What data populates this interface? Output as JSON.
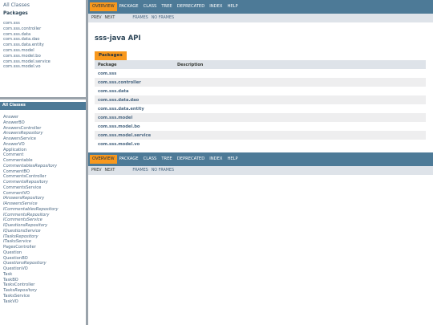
{
  "left_top": {
    "all_classes_link": "All Classes",
    "packages_title": "Packages",
    "packages": [
      "com.sss",
      "com.sss.controller",
      "com.sss.data",
      "com.sss.data.dao",
      "com.sss.data.entity",
      "com.sss.model",
      "com.sss.model.bo",
      "com.sss.model.service",
      "com.sss.model.vo"
    ]
  },
  "left_bottom": {
    "title": "All Classes",
    "classes": [
      {
        "name": "Answer",
        "interface": false
      },
      {
        "name": "AnswerBO",
        "interface": false
      },
      {
        "name": "AnswersController",
        "interface": false
      },
      {
        "name": "AnswersRepository",
        "interface": true
      },
      {
        "name": "AnswersService",
        "interface": false
      },
      {
        "name": "AnswerVO",
        "interface": false
      },
      {
        "name": "Application",
        "interface": false
      },
      {
        "name": "Comment",
        "interface": false
      },
      {
        "name": "Commentable",
        "interface": false
      },
      {
        "name": "CommentablesRepository",
        "interface": true
      },
      {
        "name": "CommentBO",
        "interface": false
      },
      {
        "name": "CommentsController",
        "interface": false
      },
      {
        "name": "CommentsRepository",
        "interface": true
      },
      {
        "name": "CommentsService",
        "interface": false
      },
      {
        "name": "CommentVO",
        "interface": false
      },
      {
        "name": "IAnswersRepository",
        "interface": true
      },
      {
        "name": "IAnswersService",
        "interface": true
      },
      {
        "name": "ICommentablesRepository",
        "interface": true
      },
      {
        "name": "ICommentsRepository",
        "interface": true
      },
      {
        "name": "ICommentsService",
        "interface": true
      },
      {
        "name": "IQuestionsRepository",
        "interface": true
      },
      {
        "name": "IQuestionsService",
        "interface": true
      },
      {
        "name": "ITasksRepository",
        "interface": true
      },
      {
        "name": "ITasksService",
        "interface": true
      },
      {
        "name": "PagesController",
        "interface": false
      },
      {
        "name": "Question",
        "interface": false
      },
      {
        "name": "QuestionBO",
        "interface": false
      },
      {
        "name": "QuestionsRepository",
        "interface": true
      },
      {
        "name": "QuestionVO",
        "interface": false
      },
      {
        "name": "Task",
        "interface": false
      },
      {
        "name": "TaskBO",
        "interface": false
      },
      {
        "name": "TasksController",
        "interface": false
      },
      {
        "name": "TasksRepository",
        "interface": true
      },
      {
        "name": "TasksService",
        "interface": false
      },
      {
        "name": "TaskVO",
        "interface": false
      }
    ]
  },
  "nav": {
    "items": [
      "OVERVIEW",
      "PACKAGE",
      "CLASS",
      "TREE",
      "DEPRECATED",
      "INDEX",
      "HELP"
    ],
    "active_index": 0,
    "prev": "PREV",
    "next": "NEXT",
    "frames": "FRAMES",
    "no_frames": "NO FRAMES"
  },
  "main": {
    "title": "sss-java API",
    "table_caption": "Packages",
    "col_package": "Package",
    "col_description": "Description",
    "rows": [
      "com.sss",
      "com.sss.controller",
      "com.sss.data",
      "com.sss.data.dao",
      "com.sss.data.entity",
      "com.sss.model",
      "com.sss.model.bo",
      "com.sss.model.service",
      "com.sss.model.vo"
    ]
  },
  "colors": {
    "nav_bg": "#4d7a97",
    "nav_active": "#f8981d",
    "subnav_bg": "#dee3e9",
    "link": "#4a6782",
    "row_alt": "#eeeeef"
  }
}
